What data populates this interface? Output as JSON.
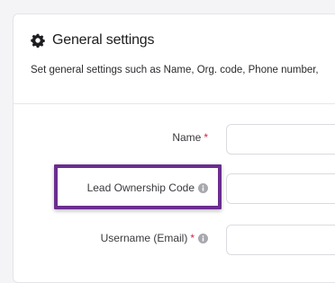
{
  "section": {
    "title": "General settings",
    "subtitle": "Set general settings such as Name, Org. code, Phone number,",
    "icon": "gear-icon"
  },
  "fields": [
    {
      "label": "Name",
      "required_mark": "*",
      "value": ""
    },
    {
      "label": "Lead Ownership Code",
      "value": ""
    },
    {
      "label": "Username (Email)",
      "required_mark": "*",
      "value": ""
    }
  ],
  "colors": {
    "highlight": "#6b2d8f",
    "required": "#d6224b"
  }
}
